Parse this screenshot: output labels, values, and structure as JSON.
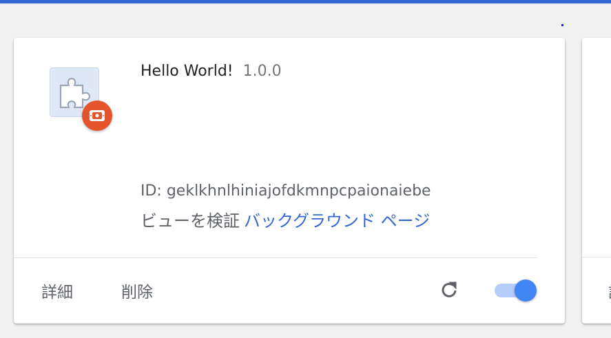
{
  "extension": {
    "name": "Hello World!",
    "version": "1.0.0",
    "id_text": "ID: geklkhnlhiniajofdkmnpcpaionaiebe",
    "inspect_views_label": "ビューを検証",
    "background_page_link": "バックグラウンド ページ",
    "enabled": true
  },
  "footer": {
    "details_label": "詳細",
    "remove_label": "削除"
  },
  "next_card": {
    "button_label": "詳"
  },
  "colors": {
    "accent": "#3367d6",
    "toggle_on": "#4285f4",
    "badge": "#e5552d"
  },
  "icons": [
    "puzzle-icon",
    "developer-mode-badge-icon",
    "reload-icon"
  ]
}
